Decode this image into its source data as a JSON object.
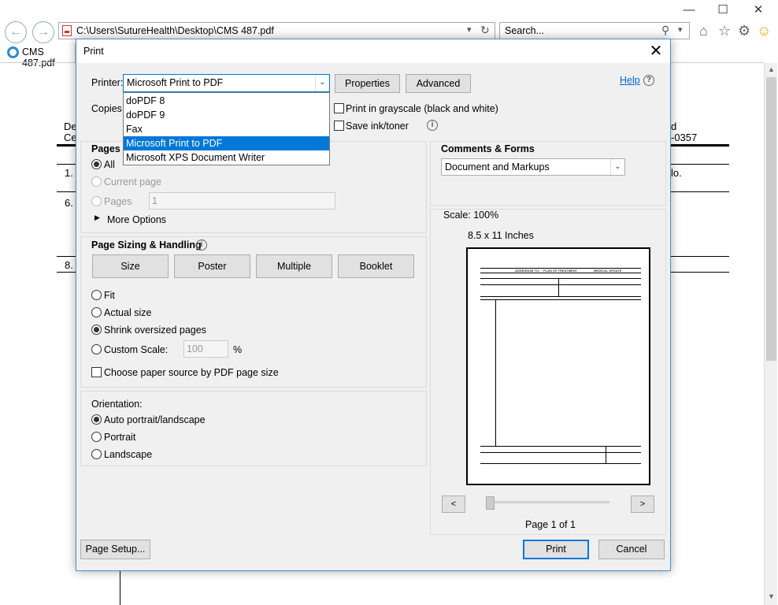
{
  "browser": {
    "address": "C:\\Users\\SutureHealth\\Desktop\\CMS 487.pdf",
    "search_placeholder": "Search...",
    "tab_label": "CMS 487.pdf"
  },
  "document_bg": {
    "left_text_1": "De",
    "left_text_2": "Ce",
    "item_1": "1.",
    "item_6": "6.",
    "item_8": "8.",
    "right_text_1": "d",
    "right_text_2": "-0357",
    "right_text_3": "lo."
  },
  "dialog": {
    "title": "Print",
    "help_label": "Help",
    "printer_label": "Printer:",
    "printer_selected": "Microsoft Print to PDF",
    "printer_options": [
      "doPDF 8",
      "doPDF 9",
      "Fax",
      "Microsoft Print to PDF",
      "Microsoft XPS Document Writer"
    ],
    "properties_label": "Properties",
    "advanced_label": "Advanced",
    "copies_label": "Copies:",
    "grayscale_label": "Print in grayscale (black and white)",
    "save_ink_label": "Save ink/toner",
    "pages_heading": "Pages t",
    "pages_all": "All",
    "pages_current": "Current page",
    "pages_pages": "Pages",
    "pages_value": "1",
    "more_options": "More Options",
    "sizing_heading": "Page Sizing & Handling",
    "size_btn": "Size",
    "poster_btn": "Poster",
    "multiple_btn": "Multiple",
    "booklet_btn": "Booklet",
    "fit_label": "Fit",
    "actual_label": "Actual size",
    "shrink_label": "Shrink oversized pages",
    "custom_label": "Custom Scale:",
    "custom_value": "100",
    "percent": "%",
    "paper_source_label": "Choose paper source by PDF page size",
    "orientation_heading": "Orientation:",
    "auto_label": "Auto portrait/landscape",
    "portrait_label": "Portrait",
    "landscape_label": "Landscape",
    "comments_heading": "Comments & Forms",
    "comments_value": "Document and Markups",
    "scale_text": "Scale: 100%",
    "paper_size": "8.5 x 11 Inches",
    "prev_btn": "<",
    "next_btn": ">",
    "page_of": "Page 1 of 1",
    "page_setup_btn": "Page Setup...",
    "print_btn": "Print",
    "cancel_btn": "Cancel"
  },
  "preview_doc": {
    "header": "ADDENDUM TO:",
    "plan": "PLAN OF TREATMENT",
    "medical": "MEDICAL UPDATE"
  }
}
